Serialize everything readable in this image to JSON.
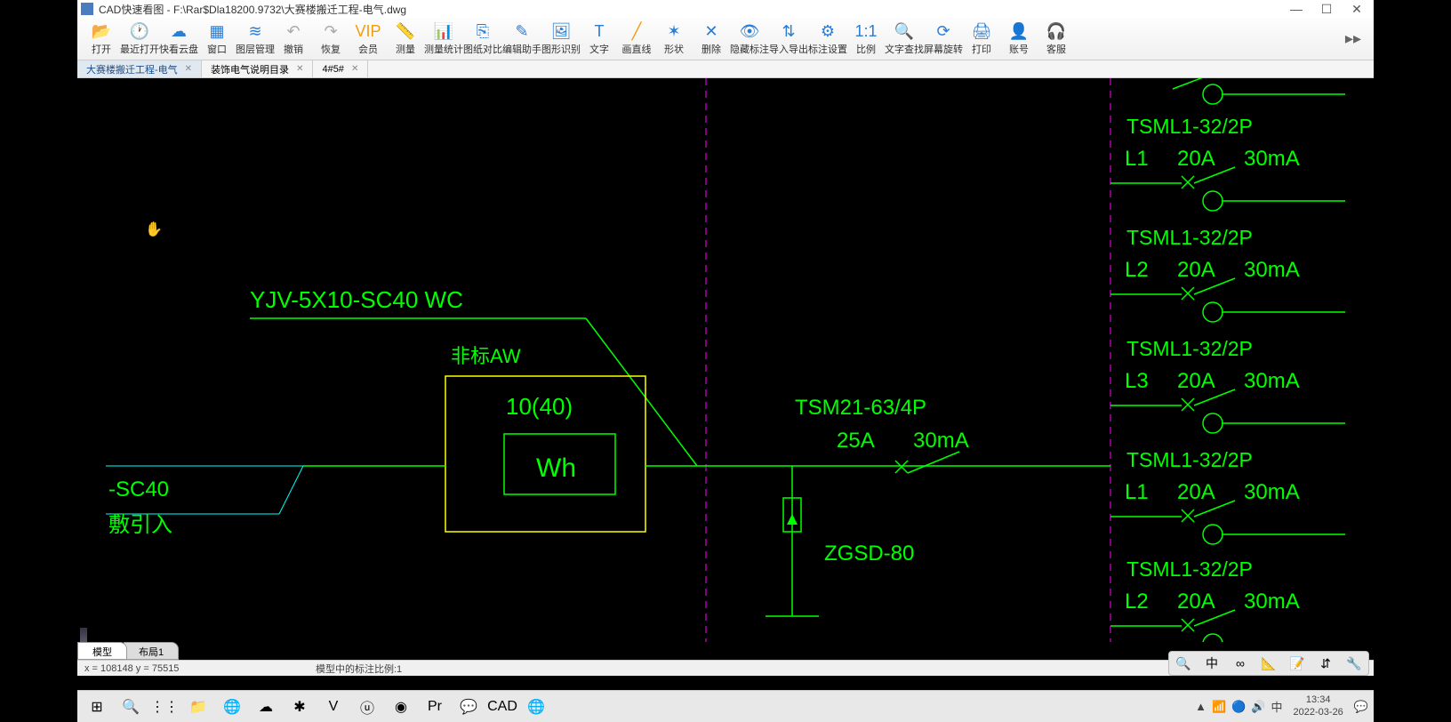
{
  "titlebar": {
    "app": "CAD快速看图",
    "path": "F:\\Rar$Dla18200.9732\\大赛楼搬迁工程-电气.dwg"
  },
  "toolbar": [
    {
      "id": "open",
      "label": "打开",
      "glyph": "📂",
      "cls": "blue"
    },
    {
      "id": "recent",
      "label": "最近打开",
      "glyph": "🕐",
      "cls": "blue"
    },
    {
      "id": "cloud",
      "label": "快看云盘",
      "glyph": "☁",
      "cls": "blue"
    },
    {
      "id": "window",
      "label": "窗口",
      "glyph": "▦",
      "cls": "blue"
    },
    {
      "id": "layer",
      "label": "图层管理",
      "glyph": "≋",
      "cls": "blue"
    },
    {
      "id": "undo",
      "label": "撤销",
      "glyph": "↶",
      "cls": "gray"
    },
    {
      "id": "redo",
      "label": "恢复",
      "glyph": "↷",
      "cls": "gray"
    },
    {
      "id": "vip",
      "label": "会员",
      "glyph": "VIP",
      "cls": "orange"
    },
    {
      "id": "measure",
      "label": "测量",
      "glyph": "📏",
      "cls": "blue"
    },
    {
      "id": "mstats",
      "label": "测量统计",
      "glyph": "📊",
      "cls": "blue"
    },
    {
      "id": "compare",
      "label": "图纸对比",
      "glyph": "⎘",
      "cls": "blue"
    },
    {
      "id": "edit",
      "label": "编辑助手",
      "glyph": "✎",
      "cls": "blue"
    },
    {
      "id": "recognize",
      "label": "图形识别",
      "glyph": "🖼",
      "cls": "blue"
    },
    {
      "id": "text",
      "label": "文字",
      "glyph": "T",
      "cls": "blue"
    },
    {
      "id": "line",
      "label": "画直线",
      "glyph": "╱",
      "cls": "orange"
    },
    {
      "id": "shape",
      "label": "形状",
      "glyph": "✶",
      "cls": "blue"
    },
    {
      "id": "delete",
      "label": "删除",
      "glyph": "✕",
      "cls": "blue"
    },
    {
      "id": "hide",
      "label": "隐藏标注",
      "glyph": "👁",
      "cls": "blue"
    },
    {
      "id": "io",
      "label": "导入导出",
      "glyph": "⇅",
      "cls": "blue"
    },
    {
      "id": "annset",
      "label": "标注设置",
      "glyph": "⚙",
      "cls": "blue"
    },
    {
      "id": "scale",
      "label": "比例",
      "glyph": "1:1",
      "cls": "blue"
    },
    {
      "id": "find",
      "label": "文字查找",
      "glyph": "🔍",
      "cls": "blue"
    },
    {
      "id": "rotate",
      "label": "屏幕旋转",
      "glyph": "⟳",
      "cls": "blue"
    },
    {
      "id": "print",
      "label": "打印",
      "glyph": "🖨",
      "cls": "blue"
    },
    {
      "id": "account",
      "label": "账号",
      "glyph": "👤",
      "cls": "blue"
    },
    {
      "id": "support",
      "label": "客服",
      "glyph": "🎧",
      "cls": "blue"
    }
  ],
  "tabs": [
    {
      "label": "大赛楼搬迁工程-电气",
      "active": true
    },
    {
      "label": "装饰电气说明目录",
      "active": false
    },
    {
      "label": "4#5#",
      "active": false
    }
  ],
  "drawing": {
    "cable_label": "YJV-5X10-SC40 WC",
    "left_cable": "-SC40",
    "left_note": "敷引入",
    "box_label": "非标AW",
    "box_rating": "10(40)",
    "box_unit": "Wh",
    "main_breaker": "TSM21-63/4P",
    "main_cur": "25A",
    "main_leak": "30mA",
    "spd": "ZGSD-80",
    "branches": [
      {
        "model": "TSML1-32/2P",
        "phase": "L1",
        "cur": "20A",
        "leak": "30mA"
      },
      {
        "model": "TSML1-32/2P",
        "phase": "L2",
        "cur": "20A",
        "leak": "30mA"
      },
      {
        "model": "TSML1-32/2P",
        "phase": "L3",
        "cur": "20A",
        "leak": "30mA"
      },
      {
        "model": "TSML1-32/2P",
        "phase": "L1",
        "cur": "20A",
        "leak": "30mA"
      },
      {
        "model": "TSML1-32/2P",
        "phase": "L2",
        "cur": "20A",
        "leak": "30mA"
      }
    ]
  },
  "bottom_tabs": [
    {
      "label": "模型",
      "active": true
    },
    {
      "label": "布局1",
      "active": false
    }
  ],
  "status": {
    "coords": "x = 108148  y = 75515",
    "scale": "模型中的标注比例:1"
  },
  "right_tools": [
    "🔍",
    "中",
    "∞",
    "📐",
    "📝",
    "⇵",
    "🔧"
  ],
  "taskbar": {
    "apps": [
      "⊞",
      "🔍",
      "⋮⋮",
      "📁",
      "🌐",
      "☁",
      "✱",
      "V",
      "ⓤ",
      "◉",
      "Pr",
      "💬",
      "CAD",
      "🌐"
    ],
    "tray": [
      "▲",
      "📶",
      "🔵",
      "🔊",
      "中"
    ],
    "time": "13:34",
    "date": "2022-03-26"
  }
}
